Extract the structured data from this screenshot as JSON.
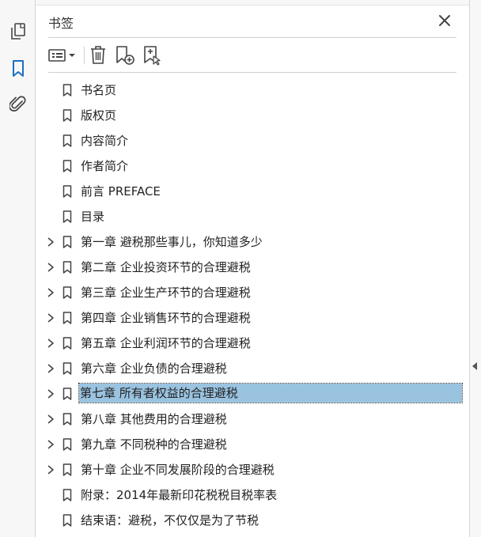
{
  "panel": {
    "title": "书签"
  },
  "sidebar": {
    "icons": [
      "pages-icon",
      "bookmarks-icon",
      "attachments-icon"
    ]
  },
  "toolbar": {
    "icons": [
      "options-menu-icon",
      "delete-icon",
      "new-bookmark-icon",
      "new-bookmark-from-structure-icon"
    ]
  },
  "bookmarks": [
    {
      "label": "书名页",
      "expandable": false
    },
    {
      "label": "版权页",
      "expandable": false
    },
    {
      "label": "内容简介",
      "expandable": false
    },
    {
      "label": "作者简介",
      "expandable": false
    },
    {
      "label": "前言 PREFACE",
      "expandable": false
    },
    {
      "label": "目录",
      "expandable": false
    },
    {
      "label": "第一章 避税那些事儿，你知道多少",
      "expandable": true
    },
    {
      "label": "第二章 企业投资环节的合理避税",
      "expandable": true
    },
    {
      "label": "第三章 企业生产环节的合理避税",
      "expandable": true
    },
    {
      "label": "第四章 企业销售环节的合理避税",
      "expandable": true
    },
    {
      "label": "第五章 企业利润环节的合理避税",
      "expandable": true
    },
    {
      "label": "第六章 企业负债的合理避税",
      "expandable": true
    },
    {
      "label": "第七章 所有者权益的合理避税",
      "expandable": true,
      "selected": true
    },
    {
      "label": "第八章 其他费用的合理避税",
      "expandable": true
    },
    {
      "label": "第九章 不同税种的合理避税",
      "expandable": true
    },
    {
      "label": "第十章 企业不同发展阶段的合理避税",
      "expandable": true
    },
    {
      "label": "附录：2014年最新印花税税目税率表",
      "expandable": false
    },
    {
      "label": "结束语：避税，不仅仅是为了节税",
      "expandable": false
    }
  ],
  "colors": {
    "selection": "#9ac3e0",
    "accent": "#1d6fc4"
  }
}
